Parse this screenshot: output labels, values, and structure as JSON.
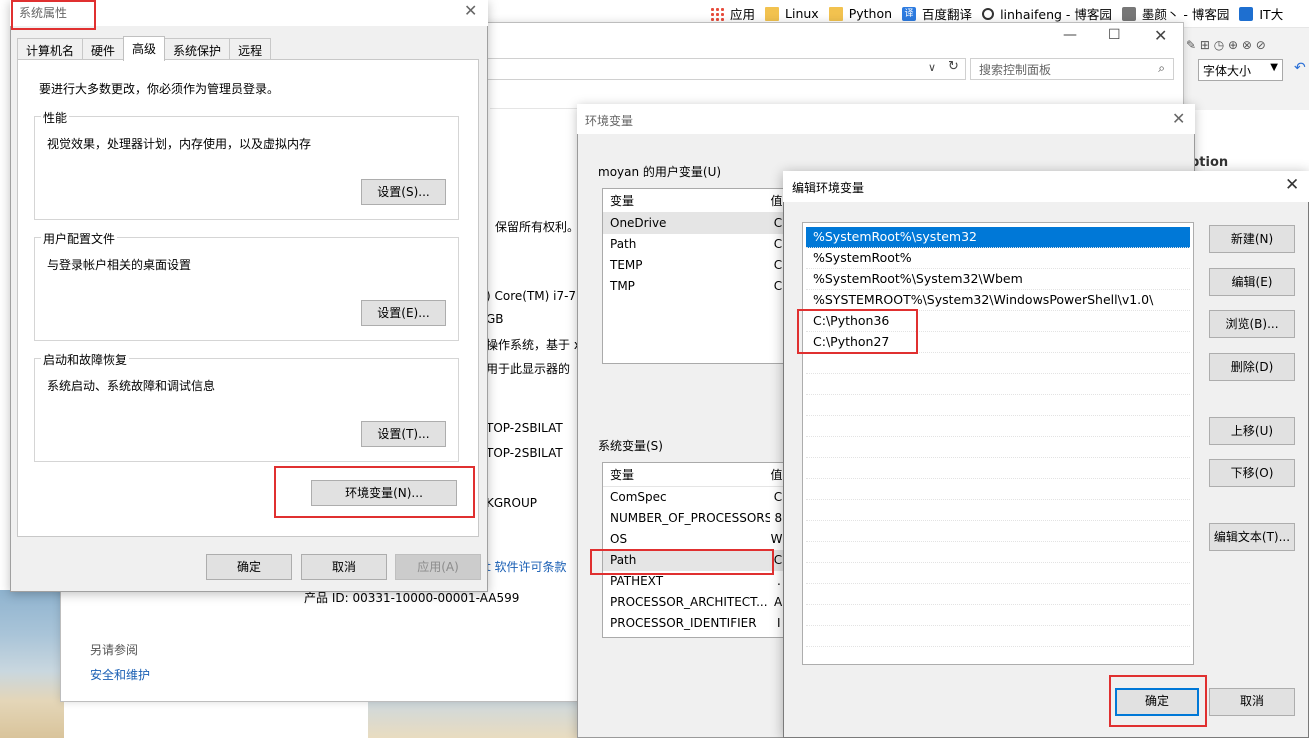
{
  "bookmarks": [
    "应用",
    "Linux",
    "Python",
    "百度翻译",
    "linhaifeng - 博客园",
    "墨颜丶 - 博客园",
    "IT大"
  ],
  "ie_toolbar": {
    "font_size_label": "字体大小"
  },
  "control_panel": {
    "search_placeholder": "搜索控制面板",
    "rights": "保留所有权利。",
    "cpu": ") Core(TM) i7-7",
    "ram": "GB",
    "os_type": "操作系统，基于 x",
    "pen": "用于此显示器的",
    "computer_name": "TOP-2SBILAT",
    "full_name": "TOP-2SBILAT",
    "workgroup": "KGROUP",
    "license_link": "t 软件许可条款",
    "product_id": "产品 ID: 00331-10000-00001-AA599",
    "see_also": "另请参阅",
    "security_link": "安全和维护",
    "option_partial": "ption"
  },
  "system_properties": {
    "title": "系统属性",
    "tabs": [
      "计算机名",
      "硬件",
      "高级",
      "系统保护",
      "远程"
    ],
    "active_tab": "高级",
    "admin_note": "要进行大多数更改，你必须作为管理员登录。",
    "performance": {
      "label": "性能",
      "desc": "视觉效果，处理器计划，内存使用，以及虚拟内存",
      "button": "设置(S)..."
    },
    "user_profiles": {
      "label": "用户配置文件",
      "desc": "与登录帐户相关的桌面设置",
      "button": "设置(E)..."
    },
    "startup": {
      "label": "启动和故障恢复",
      "desc": "系统启动、系统故障和调试信息",
      "button": "设置(T)..."
    },
    "env_button": "环境变量(N)...",
    "ok": "确定",
    "cancel": "取消",
    "apply": "应用(A)"
  },
  "env_vars": {
    "title": "环境变量",
    "user_section": "moyan 的用户变量(U)",
    "system_section": "系统变量(S)",
    "col_var": "变量",
    "col_val": "值",
    "user_vars": [
      {
        "name": "OneDrive",
        "value": "C"
      },
      {
        "name": "Path",
        "value": "C"
      },
      {
        "name": "TEMP",
        "value": "C"
      },
      {
        "name": "TMP",
        "value": "C"
      }
    ],
    "system_vars": [
      {
        "name": "ComSpec",
        "value": "C"
      },
      {
        "name": "NUMBER_OF_PROCESSORS",
        "value": "8"
      },
      {
        "name": "OS",
        "value": "W"
      },
      {
        "name": "Path",
        "value": "C"
      },
      {
        "name": "PATHEXT",
        "value": "."
      },
      {
        "name": "PROCESSOR_ARCHITECT...",
        "value": "A"
      },
      {
        "name": "PROCESSOR_IDENTIFIER",
        "value": "I"
      }
    ]
  },
  "edit_env": {
    "title": "编辑环境变量",
    "paths": [
      "%SystemRoot%\\system32",
      "%SystemRoot%",
      "%SystemRoot%\\System32\\Wbem",
      "%SYSTEMROOT%\\System32\\WindowsPowerShell\\v1.0\\",
      "C:\\Python36",
      "C:\\Python27"
    ],
    "buttons": {
      "new": "新建(N)",
      "edit": "编辑(E)",
      "browse": "浏览(B)...",
      "delete": "删除(D)",
      "up": "上移(U)",
      "down": "下移(O)",
      "edit_text": "编辑文本(T)..."
    },
    "ok": "确定",
    "cancel": "取消"
  },
  "colors": {
    "highlight_red": "#e03030",
    "selection_blue": "#0078d7"
  }
}
